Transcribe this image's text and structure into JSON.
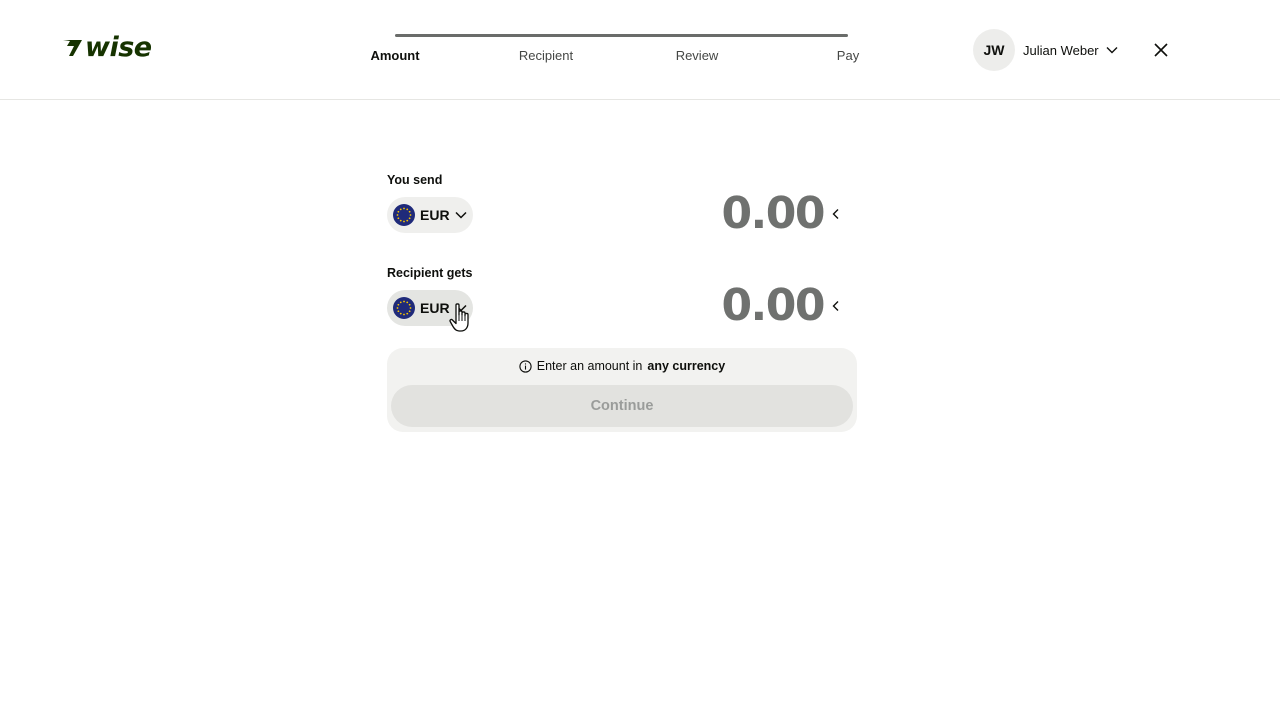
{
  "header": {
    "logo_text": "wise",
    "steps": [
      {
        "label": "Amount",
        "active": true
      },
      {
        "label": "Recipient",
        "active": false
      },
      {
        "label": "Review",
        "active": false
      },
      {
        "label": "Pay",
        "active": false
      }
    ],
    "user": {
      "initials": "JW",
      "name": "Julian Weber"
    },
    "icons": {
      "user_menu": "chevron-down-icon",
      "close": "close-icon"
    }
  },
  "transfer": {
    "send": {
      "label": "You send",
      "currency": "EUR",
      "amount": "0.00"
    },
    "receive": {
      "label": "Recipient gets",
      "currency": "EUR",
      "amount": "0.00"
    },
    "hint_prefix": "Enter an amount in",
    "hint_emphasis": "any currency",
    "continue_label": "Continue"
  },
  "colors": {
    "brand": "#163300",
    "eu_flag_blue": "#1f2a7a",
    "eu_flag_stars": "#f5c400"
  }
}
